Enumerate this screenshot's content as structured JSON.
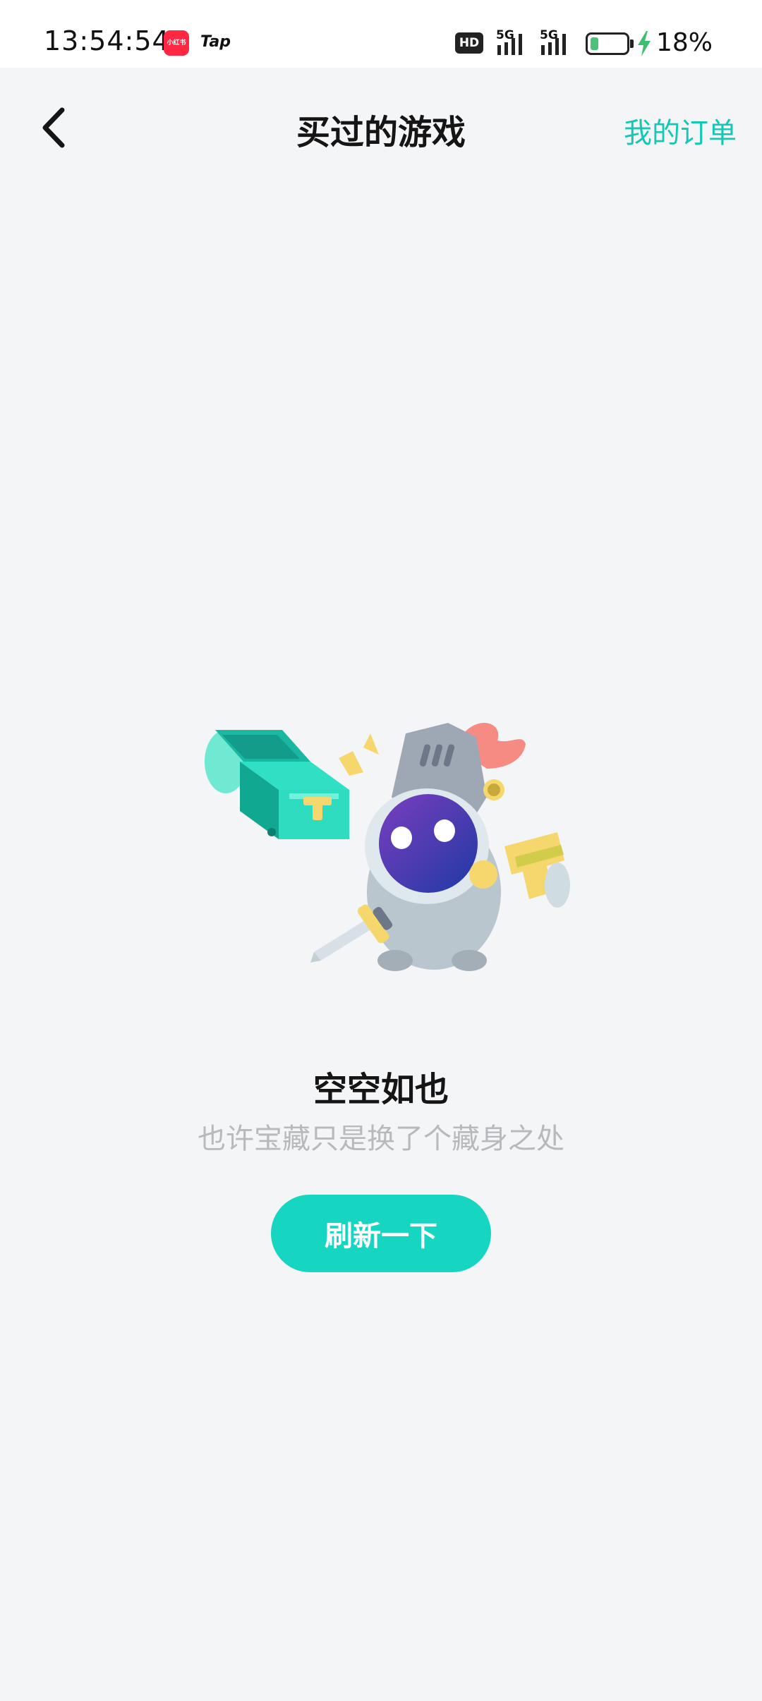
{
  "status_bar": {
    "time": "13:54:54",
    "apps": [
      {
        "icon": "xiaohongshu-icon",
        "label": "小红书"
      },
      {
        "icon": "taptap-icon",
        "label": "Tap"
      }
    ],
    "hd_label": "HD",
    "network_1": "5G",
    "network_2": "5G",
    "battery_level": 0.18,
    "battery_text": "18%",
    "charging": true,
    "colors": {
      "battery": "#4cc37a"
    }
  },
  "header": {
    "back_icon": "chevron-left-icon",
    "title": "买过的游戏",
    "orders_link": "我的订单"
  },
  "empty_state": {
    "illustration": "knight-with-treasure-chest-illustration",
    "title": "空空如也",
    "subtitle": "也许宝藏只是换了个藏身之处",
    "refresh_button": "刷新一下"
  },
  "colors": {
    "accent": "#16d6c2",
    "link": "#14c8b5",
    "background": "#f4f5f7",
    "subtitle": "#b7b9bd"
  }
}
